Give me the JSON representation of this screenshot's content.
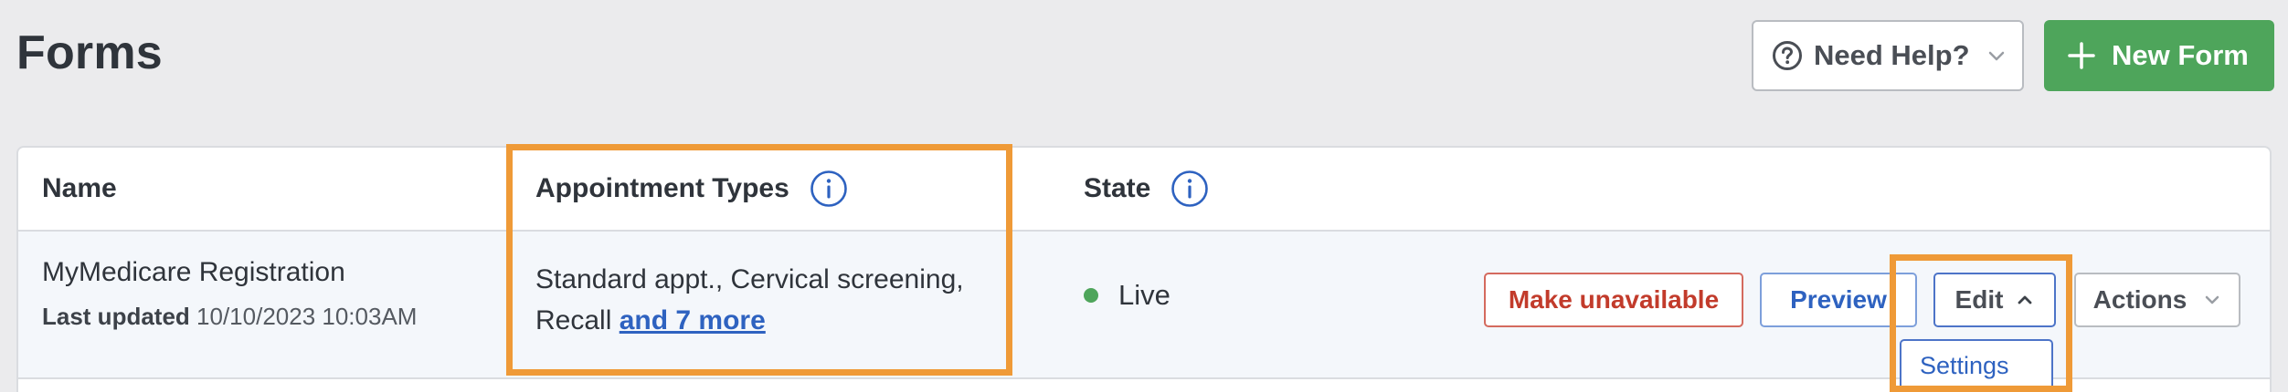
{
  "header": {
    "title": "Forms",
    "help_label": "Need Help?",
    "new_form_label": "New Form"
  },
  "table": {
    "columns": [
      "Name",
      "Appointment Types",
      "State"
    ],
    "row": {
      "name": "MyMedicare Registration",
      "updated_label": "Last updated",
      "updated_value": "10/10/2023 10:03AM",
      "types_line1": "Standard appt., Cervical screening,",
      "types_line2": "Recall",
      "types_more": "and 7 more",
      "state": "Live",
      "state_color": "#4ea55b"
    },
    "actions": {
      "make_unavailable": "Make unavailable",
      "preview": "Preview",
      "edit": "Edit",
      "actions": "Actions",
      "edit_menu": [
        "Settings"
      ]
    }
  },
  "colors": {
    "primary_green": "#4ea55b",
    "link_blue": "#2e62c0",
    "danger_red": "#c23b2b",
    "highlight_orange": "#ef9a37"
  },
  "icons": {
    "help": "question-circle-icon",
    "add": "plus-icon",
    "info": "info-circle-icon",
    "expand": "chevron-down-icon",
    "collapse": "chevron-up-icon"
  }
}
